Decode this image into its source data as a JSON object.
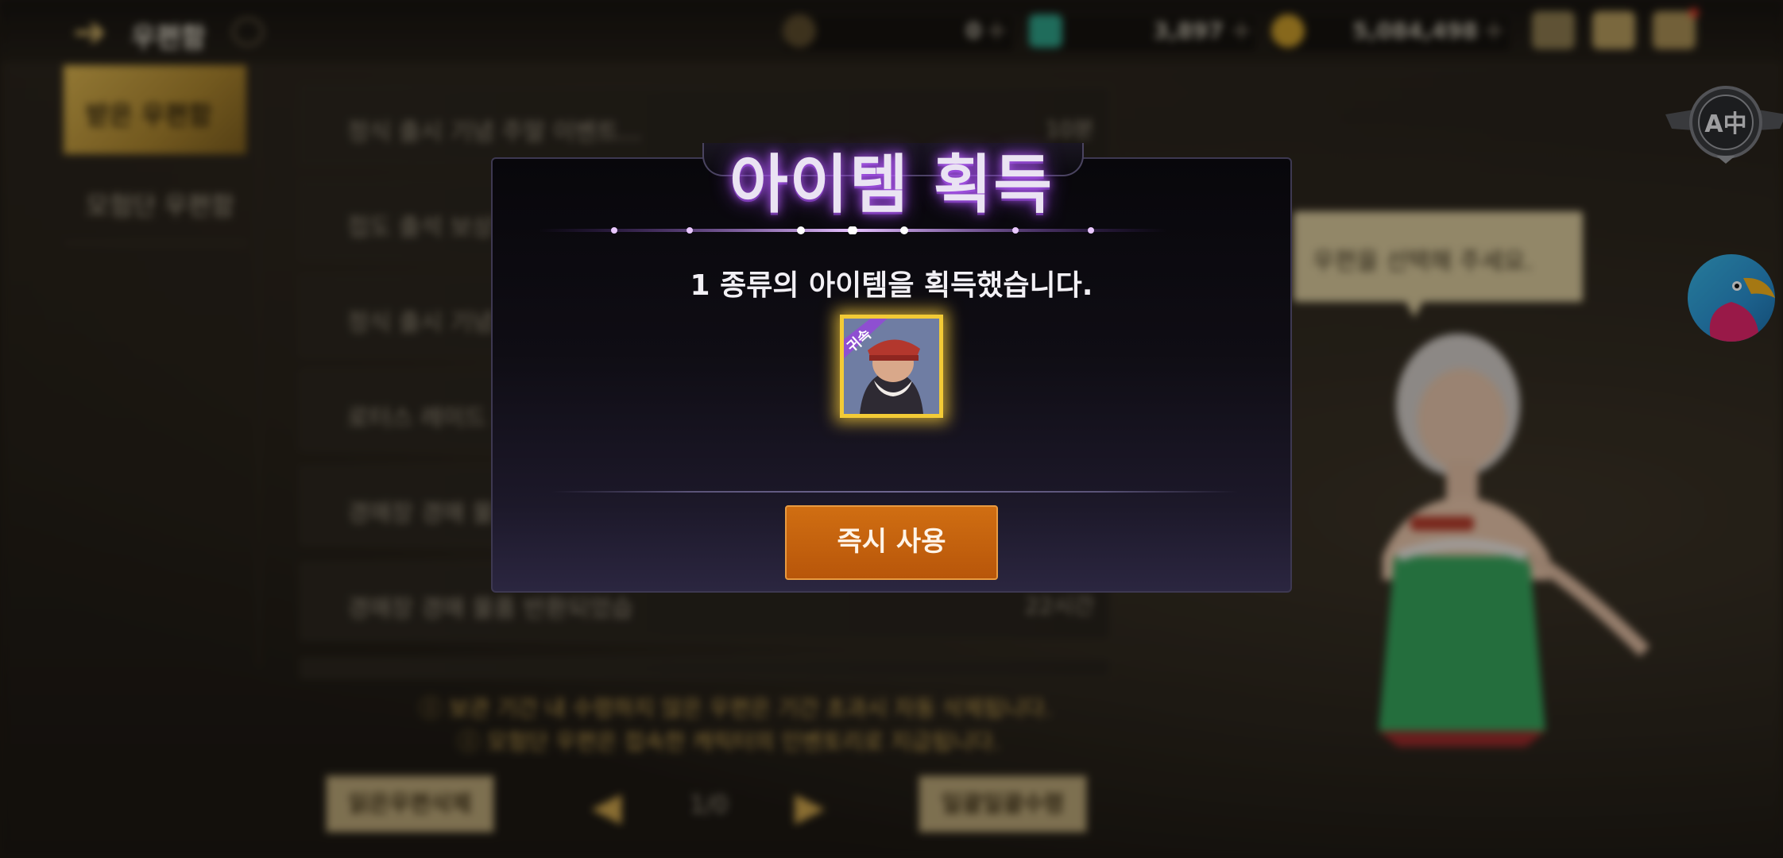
{
  "header": {
    "title": "우편함",
    "currencies": [
      {
        "value": "0",
        "icon": "coin-c-icon"
      },
      {
        "value": "3,897",
        "icon": "gem-icon"
      },
      {
        "value": "5,084,498",
        "icon": "gold-coin-icon"
      }
    ],
    "right_icons": [
      "bag-icon",
      "mail-icon",
      "chat-icon"
    ]
  },
  "sidebar": {
    "tabs": [
      {
        "label": "받은 우편함",
        "active": true
      },
      {
        "label": "모험단 우편함",
        "active": false
      }
    ]
  },
  "mail_list": {
    "rows": [
      {
        "title": "정식 출시 기념 주말 이벤트...",
        "time": "10분"
      },
      {
        "title": "접도 출석 보상",
        "time": ""
      },
      {
        "title": "정식 출시 기념",
        "time": ""
      },
      {
        "title": "로터스 레이드 지",
        "time": ""
      },
      {
        "title": "경매장 경매 물품",
        "time": ""
      },
      {
        "title": "경매장 경매 물품 반환되었습",
        "time": "22시간"
      }
    ]
  },
  "notices": [
    "보관 기간 내 수령하지 않은 우편은 기간 초과시 자동 삭제됩니다.",
    "모험단 우편은 접속한 캐릭터의 인벤토리로 지급됩니다."
  ],
  "footer": {
    "delete_read_label": "읽은우편삭제",
    "page_indicator": "1/0",
    "receive_all_label": "일괄일괄수령"
  },
  "npc": {
    "speech": "우편을 선택해 주세요."
  },
  "modal": {
    "title": "아이템 획득",
    "message": "1 종류의 아이템을 획득했습니다.",
    "item_badge": "귀속",
    "use_button": "즉시 사용"
  },
  "colors": {
    "accent_gold": "#d9b24e",
    "modal_title_glow": "#b05cf0",
    "use_button": "#c4620e",
    "item_frame": "#f3cb36"
  }
}
